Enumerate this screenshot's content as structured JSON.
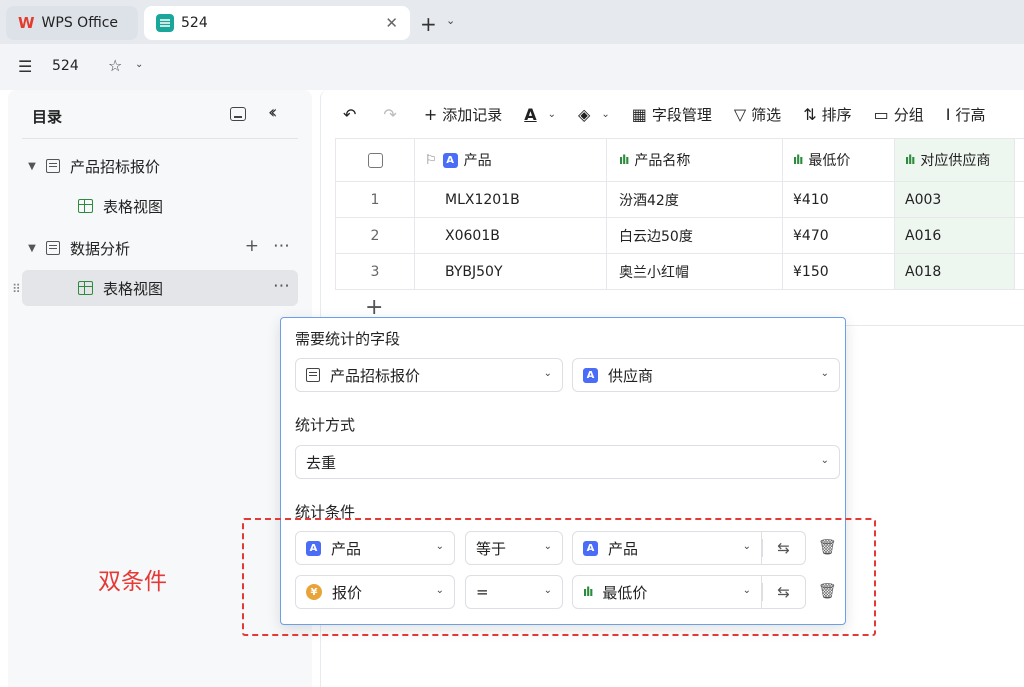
{
  "tabs": {
    "wps_label": "WPS Office",
    "doc_label": "524"
  },
  "header": {
    "title": "524"
  },
  "sidebar": {
    "title": "目录",
    "items": [
      {
        "label": "产品招标报价"
      },
      {
        "label": "表格视图"
      },
      {
        "label": "数据分析"
      },
      {
        "label": "表格视图"
      }
    ]
  },
  "toolbar": {
    "add_record": "添加记录",
    "field_manage": "字段管理",
    "filter": "筛选",
    "sort": "排序",
    "group": "分组",
    "row_height": "行高"
  },
  "table": {
    "columns": [
      "产品",
      "产品名称",
      "最低价",
      "对应供应商"
    ],
    "rows": [
      {
        "num": "1",
        "product": "MLX1201B",
        "name": "汾酒42度",
        "price": "¥410",
        "supplier": "A003"
      },
      {
        "num": "2",
        "product": "X0601B",
        "name": "白云边50度",
        "price": "¥470",
        "supplier": "A016"
      },
      {
        "num": "3",
        "product": "BYBJ50Y",
        "name": "奥兰小红帽",
        "price": "¥150",
        "supplier": "A018"
      }
    ]
  },
  "popup": {
    "field_label": "需要统计的字段",
    "table_select": "产品招标报价",
    "field_select": "供应商",
    "method_label": "统计方式",
    "method_select": "去重",
    "condition_label": "统计条件",
    "conditions": [
      {
        "field": "产品",
        "op": "等于",
        "target": "产品"
      },
      {
        "field": "报价",
        "op": "=",
        "target": "最低价"
      }
    ]
  },
  "annotation": {
    "label": "双条件",
    "color": "#e53935"
  },
  "colors": {
    "accent_blue": "#4a6cf7",
    "field_green": "#2e8b3e",
    "wps_red": "#e33b2e",
    "app_teal": "#1aa69a"
  }
}
